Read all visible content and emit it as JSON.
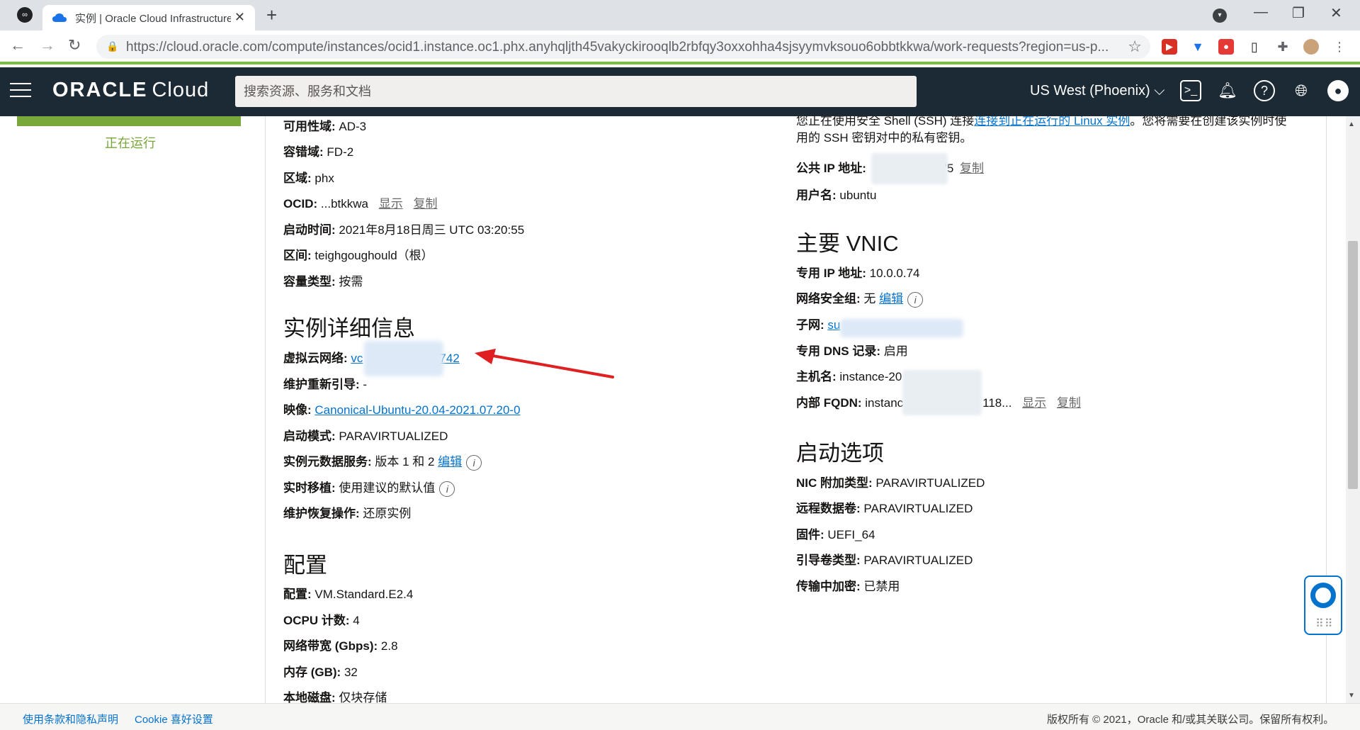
{
  "browser": {
    "tab_title": "实例 | Oracle Cloud Infrastructure",
    "url": "https://cloud.oracle.com/compute/instances/ocid1.instance.oc1.phx.anyhqljth45vakyckirooqlb2rbfqy3oxxohha4sjsyymvksouo6obbtkkwa/work-requests?region=us-p...",
    "new_tab": "+",
    "close": "✕"
  },
  "header": {
    "brand": "ORACLE",
    "product": "Cloud",
    "search_placeholder": "搜索资源、服务和文档",
    "region": "US West (Phoenix)"
  },
  "instance_status": "正在运行",
  "general": [
    {
      "label": "可用性域:",
      "value": "AD-3"
    },
    {
      "label": "容错域:",
      "value": "FD-2"
    },
    {
      "label": "区域:",
      "value": "phx"
    },
    {
      "label": "OCID:",
      "value": "...btkkwa",
      "show": "显示",
      "copy": "复制"
    },
    {
      "label": "启动时间:",
      "value": "2021年8月18日周三 UTC 03:20:55"
    },
    {
      "label": "区间:",
      "value": "teighgoughould（根）"
    },
    {
      "label": "容量类型:",
      "value": "按需"
    }
  ],
  "instance_details": {
    "title": "实例详细信息",
    "vcn_label": "虚拟云网络:",
    "vcn_link_prefix": "vc",
    "vcn_link_suffix": "742",
    "reboot_label": "维护重新引导:",
    "reboot_value": "-",
    "image_label": "映像:",
    "image_value": "Canonical-Ubuntu-20.04-2021.07.20-0",
    "launch_mode_label": "启动模式:",
    "launch_mode_value": "PARAVIRTUALIZED",
    "metadata_label": "实例元数据服务:",
    "metadata_value": "版本 1 和 2",
    "metadata_edit": "编辑",
    "live_migration_label": "实时移植:",
    "live_migration_value": "使用建议的默认值",
    "recovery_label": "维护恢复操作:",
    "recovery_value": "还原实例"
  },
  "config": {
    "title": "配置",
    "rows": [
      {
        "label": "配置:",
        "value": "VM.Standard.E2.4"
      },
      {
        "label": "OCPU 计数:",
        "value": "4"
      },
      {
        "label": "网络带宽 (Gbps):",
        "value": "2.8"
      },
      {
        "label": "内存 (GB):",
        "value": "32"
      },
      {
        "label": "本地磁盘:",
        "value": "仅块存储"
      }
    ]
  },
  "access": {
    "ssh_note_1a": "您正在使用安全 Shell (SSH) 连接",
    "ssh_note_link": "连接到正在运行的 Linux 实例",
    "ssh_note_1b": "。您将需要在创建该实例时使",
    "ssh_note_2": "用的 SSH 密钥对中的私有密钥。",
    "public_ip_label": "公共 IP 地址:",
    "public_ip_suffix": "'5",
    "copy": "复制",
    "username_label": "用户名:",
    "username_value": "ubuntu"
  },
  "vnic": {
    "title": "主要 VNIC",
    "private_ip_label": "专用 IP 地址:",
    "private_ip_value": "10.0.0.74",
    "nsg_label": "网络安全组:",
    "nsg_value": "无",
    "nsg_edit": "编辑",
    "subnet_label": "子网:",
    "subnet_prefix": "su",
    "dns_label": "专用 DNS 记录:",
    "dns_value": "启用",
    "hostname_label": "主机名:",
    "hostname_value": "instance-20",
    "fqdn_label": "内部 FQDN:",
    "fqdn_prefix": "instanc",
    "fqdn_suffix": "118...",
    "show": "显示",
    "copy": "复制"
  },
  "launch_options": {
    "title": "启动选项",
    "rows": [
      {
        "label": "NIC 附加类型:",
        "value": "PARAVIRTUALIZED"
      },
      {
        "label": "远程数据卷:",
        "value": "PARAVIRTUALIZED"
      },
      {
        "label": "固件:",
        "value": "UEFI_64"
      },
      {
        "label": "引导卷类型:",
        "value": "PARAVIRTUALIZED"
      },
      {
        "label": "传输中加密:",
        "value": "已禁用"
      }
    ]
  },
  "footer": {
    "terms": "使用条款和隐私声明",
    "cookie": "Cookie 喜好设置",
    "copyright": "版权所有 © 2021，Oracle 和/或其关联公司。保留所有权利。"
  },
  "colors": {
    "header_bg": "#1b2a35",
    "running_green": "#78a73a",
    "link_blue": "#0572ce",
    "annotation_red": "#e02020"
  }
}
